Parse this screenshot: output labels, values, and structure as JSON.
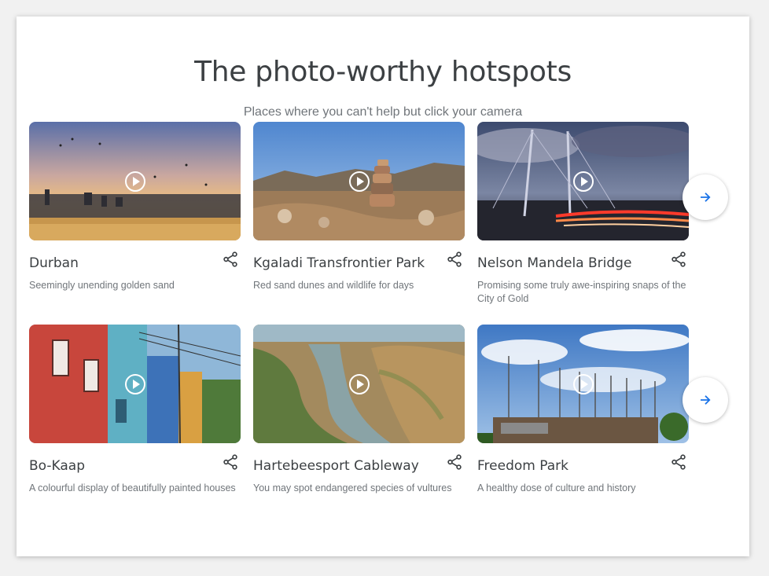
{
  "header": {
    "title": "The photo-worthy hotspots",
    "subtitle": "Places where you can't help but click your camera"
  },
  "rows": [
    {
      "cards": [
        {
          "name": "Durban",
          "description": "Seemingly unending golden sand",
          "image": "sunset-city-beach-birds"
        },
        {
          "name": "Kgaladi Transfrontier Park",
          "description": "Red sand dunes and wildlife for days",
          "image": "stacked-rocks-mountains"
        },
        {
          "name": "Nelson Mandela Bridge",
          "description": "Promising some truly awe-inspiring snaps of the City of Gold",
          "image": "cable-bridge-night-traffic"
        }
      ],
      "next_icon": "arrow-right-icon"
    },
    {
      "cards": [
        {
          "name": "Bo-Kaap",
          "description": "A colourful display of beautifully painted houses",
          "image": "colourful-houses-street"
        },
        {
          "name": "Hartebeesport Cableway",
          "description": "You may spot endangered species of vultures",
          "image": "river-valley-aerial"
        },
        {
          "name": "Freedom Park",
          "description": "A healthy dose of culture and history",
          "image": "monument-reeds-sky"
        }
      ],
      "next_icon": "arrow-right-icon"
    }
  ],
  "colors": {
    "accent": "#1a73e8",
    "title": "#3c4043",
    "muted": "#70757a"
  }
}
